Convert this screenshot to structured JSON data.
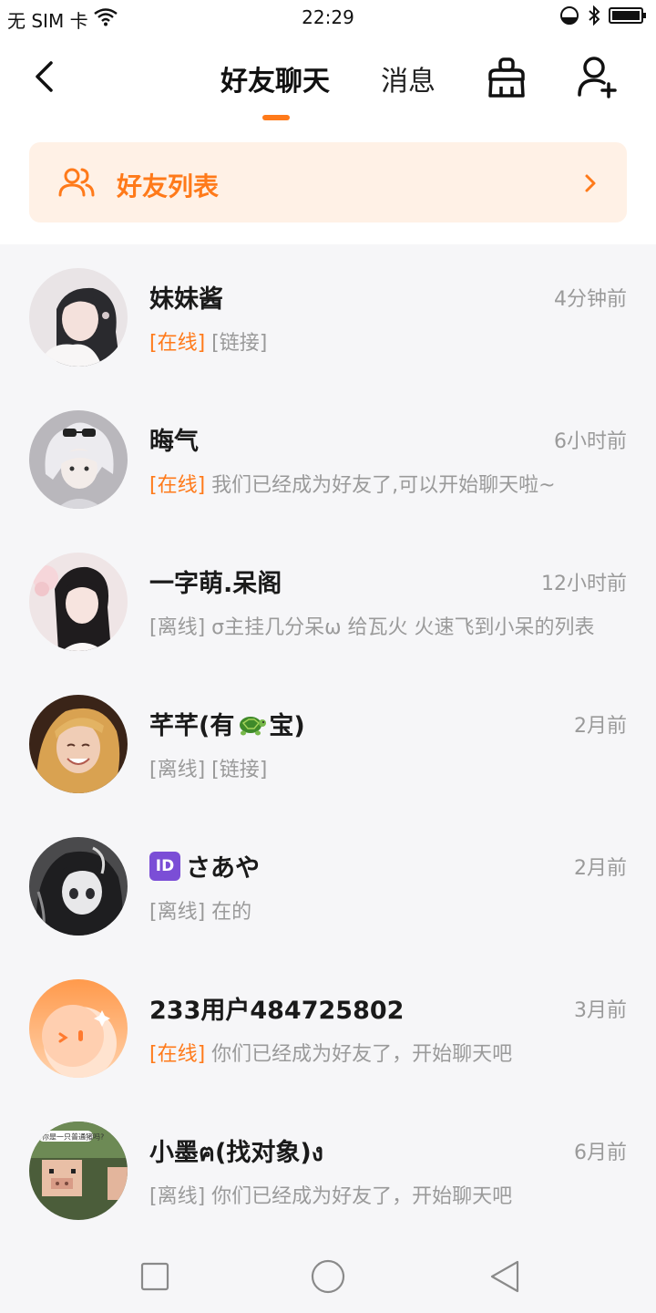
{
  "status_bar": {
    "carrier": "无 SIM 卡",
    "time": "22:29"
  },
  "header": {
    "tab_chat": "好友聊天",
    "tab_messages": "消息"
  },
  "friends_list": {
    "label": "好友列表"
  },
  "colors": {
    "accent": "#ff7a1a",
    "accent_bg": "#fff1e6",
    "secondary_text": "#9a9a9a"
  },
  "chats": [
    {
      "name": "妹妹酱",
      "time": "4分钟前",
      "status": "[在线]",
      "message": "[链接]"
    },
    {
      "name": "晦气",
      "time": "6小时前",
      "status": "[在线]",
      "message": "我们已经成为好友了,可以开始聊天啦~"
    },
    {
      "name": "一字萌.呆阁",
      "time": "12小时前",
      "status": "[离线]",
      "message": "σ主挂几分呆ω 给瓦火 火速飞到小呆的列表"
    },
    {
      "name_prefix": "芊芊(有",
      "name_suffix": "宝)",
      "name_emoji": "turtle-emoji",
      "time": "2月前",
      "status": "[离线]",
      "message": "[链接]"
    },
    {
      "badge": "ID",
      "name": "さあや",
      "time": "2月前",
      "status": "[离线]",
      "message": "在的"
    },
    {
      "name": "233用户484725802",
      "time": "3月前",
      "status": "[在线]",
      "message": "你们已经成为好友了，开始聊天吧"
    },
    {
      "name": "小墨ฅ(找对象)ง",
      "time": "6月前",
      "status": "[离线]",
      "message": "你们已经成为好友了，开始聊天吧",
      "avatar_caption": "你是一只普通猪吗?"
    }
  ],
  "icons": {
    "back": "back-arrow-icon",
    "clean": "broom-icon",
    "add_friend": "add-user-icon",
    "friends": "friends-group-icon",
    "chevron": "chevron-right-icon",
    "nav_recent": "square-icon",
    "nav_home": "circle-icon",
    "nav_back": "triangle-back-icon"
  }
}
